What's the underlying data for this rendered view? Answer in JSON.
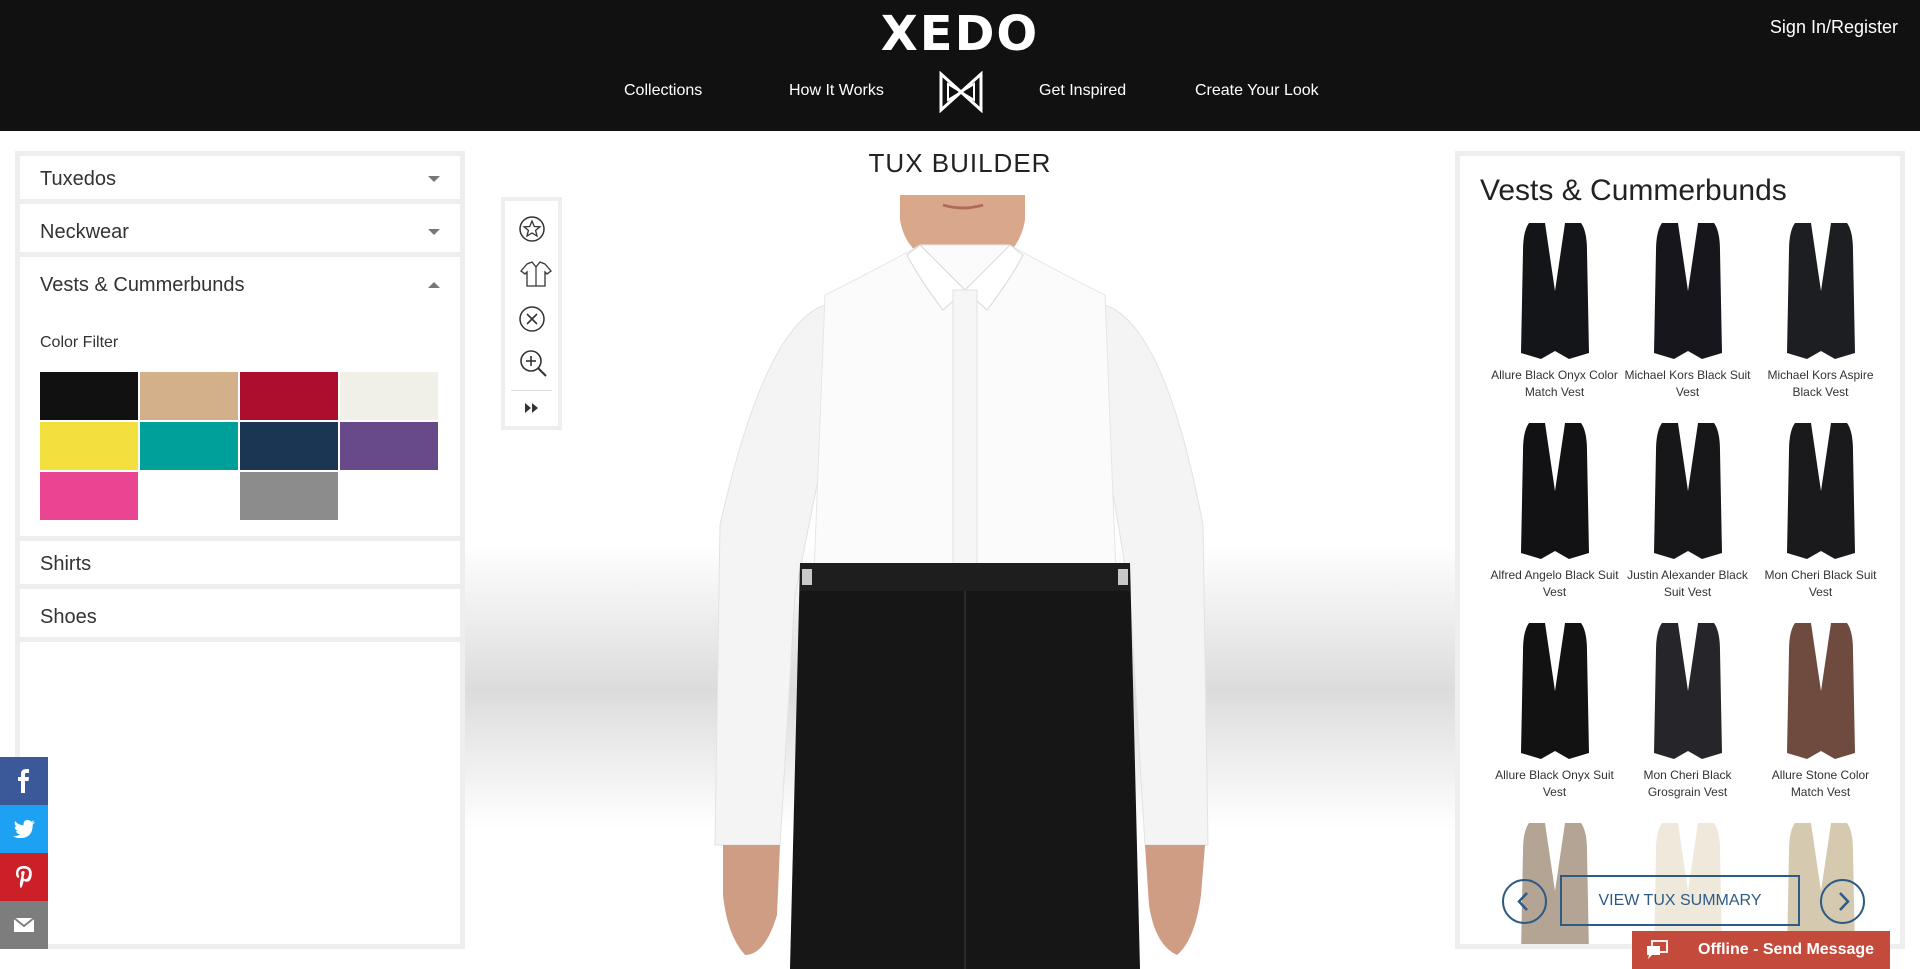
{
  "header": {
    "logo": "XEDO",
    "sign_in": "Sign In/Register",
    "nav": [
      "Collections",
      "How It Works",
      "Get Inspired",
      "Create Your Look"
    ]
  },
  "left": {
    "accordion": [
      "Tuxedos",
      "Neckwear",
      "Vests & Cummerbunds",
      "Shirts",
      "Shoes"
    ],
    "color_filter_label": "Color Filter",
    "swatches": [
      "#111111",
      "#d4b08a",
      "#ac0f2e",
      "#f1f0e8",
      "#f3e03f",
      "#00a09a",
      "#1a3653",
      "#684989",
      "#e94593",
      "#ffffff",
      "#8c8c8c"
    ]
  },
  "center": {
    "title": "TUX BUILDER"
  },
  "right": {
    "title": "Vests & Cummerbunds",
    "vests": [
      {
        "name": "Allure Black Onyx Color Match Vest",
        "color": "#141518"
      },
      {
        "name": "Michael Kors Black Suit Vest",
        "color": "#17161d"
      },
      {
        "name": "Michael Kors Aspire Black Vest",
        "color": "#1d1e22"
      },
      {
        "name": "Alfred Angelo Black Suit Vest",
        "color": "#121214"
      },
      {
        "name": "Justin Alexander Black Suit Vest",
        "color": "#17171a"
      },
      {
        "name": "Mon Cheri Black Suit Vest",
        "color": "#1a1a1c"
      },
      {
        "name": "Allure Black Onyx Suit Vest",
        "color": "#121213"
      },
      {
        "name": "Mon Cheri Black Grosgrain Vest",
        "color": "#26262a"
      },
      {
        "name": "Allure Stone Color Match Vest",
        "color": "#6e4b3e"
      },
      {
        "name": "",
        "color": "#b4a493"
      },
      {
        "name": "",
        "color": "#efe9dc"
      },
      {
        "name": "",
        "color": "#d5cab0"
      }
    ],
    "summary_button": "VIEW TUX SUMMARY"
  },
  "social": [
    {
      "icon": "facebook-icon",
      "color": "#3b5998"
    },
    {
      "icon": "twitter-icon",
      "color": "#1da1f2"
    },
    {
      "icon": "pinterest-icon",
      "color": "#cb2027"
    },
    {
      "icon": "email-icon",
      "color": "#7d7d7d"
    }
  ],
  "chat": {
    "label": "Offline - Send Message"
  }
}
